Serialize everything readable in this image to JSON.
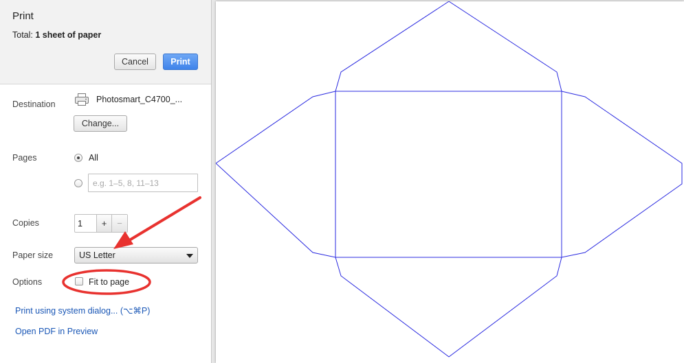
{
  "header": {
    "title": "Print",
    "total_label": "Total:",
    "total_value": "1 sheet of paper",
    "cancel_label": "Cancel",
    "print_label": "Print"
  },
  "destination": {
    "label": "Destination",
    "printer_name": "Photosmart_C4700_...",
    "change_label": "Change..."
  },
  "pages": {
    "label": "Pages",
    "all_label": "All",
    "custom_placeholder": "e.g. 1–5, 8, 11–13",
    "selected": "All"
  },
  "copies": {
    "label": "Copies",
    "value": "1",
    "plus": "+",
    "minus": "−"
  },
  "paper_size": {
    "label": "Paper size",
    "value": "US Letter"
  },
  "options": {
    "label": "Options",
    "fit_to_page_label": "Fit to page",
    "fit_to_page_checked": false
  },
  "links": {
    "system_dialog": "Print using system dialog... (⌥⌘P)",
    "open_pdf": "Open PDF in Preview"
  },
  "icons": {
    "printer": "printer-icon",
    "dropdown": "chevron-down-icon"
  },
  "colors": {
    "accent": "#4a8af0",
    "envelope_stroke": "#2a2ae0",
    "annotation_red": "#e8322f",
    "link": "#1a57b6"
  }
}
